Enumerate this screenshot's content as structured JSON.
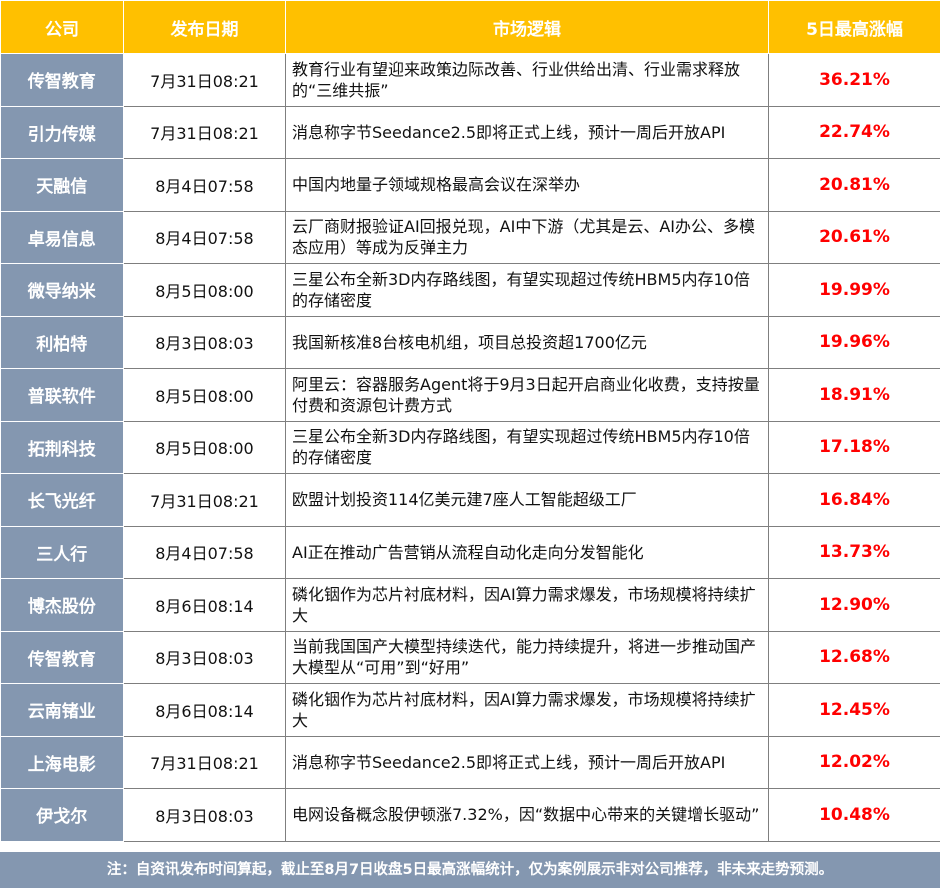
{
  "header": {
    "company": "公司",
    "date": "发布日期",
    "logic": "市场逻辑",
    "gain": "5日最高涨幅"
  },
  "rows": [
    {
      "company": "传智教育",
      "date": "7月31日08:21",
      "logic": "教育行业有望迎来政策边际改善、行业供给出清、行业需求释放的“三维共振”",
      "gain": "36.21%"
    },
    {
      "company": "引力传媒",
      "date": "7月31日08:21",
      "logic": "消息称字节Seedance2.5即将正式上线，预计一周后开放API",
      "gain": "22.74%"
    },
    {
      "company": "天融信",
      "date": "8月4日07:58",
      "logic": "中国内地量子领域规格最高会议在深举办",
      "gain": "20.81%"
    },
    {
      "company": "卓易信息",
      "date": "8月4日07:58",
      "logic": "云厂商财报验证AI回报兑现，AI中下游（尤其是云、AI办公、多模态应用）等成为反弹主力",
      "gain": "20.61%"
    },
    {
      "company": "微导纳米",
      "date": "8月5日08:00",
      "logic": "三星公布全新3D内存路线图，有望实现超过传统HBM5内存10倍的存储密度",
      "gain": "19.99%"
    },
    {
      "company": "利柏特",
      "date": "8月3日08:03",
      "logic": "我国新核准8台核电机组，项目总投资超1700亿元",
      "gain": "19.96%"
    },
    {
      "company": "普联软件",
      "date": "8月5日08:00",
      "logic": "阿里云：容器服务Agent将于9月3日起开启商业化收费，支持按量付费和资源包计费方式",
      "gain": "18.91%"
    },
    {
      "company": "拓荆科技",
      "date": "8月5日08:00",
      "logic": "三星公布全新3D内存路线图，有望实现超过传统HBM5内存10倍的存储密度",
      "gain": "17.18%"
    },
    {
      "company": "长飞光纤",
      "date": "7月31日08:21",
      "logic": "欧盟计划投资114亿美元建7座人工智能超级工厂",
      "gain": "16.84%"
    },
    {
      "company": "三人行",
      "date": "8月4日07:58",
      "logic": "AI正在推动广告营销从流程自动化走向分发智能化",
      "gain": "13.73%"
    },
    {
      "company": "博杰股份",
      "date": "8月6日08:14",
      "logic": "磷化铟作为芯片衬底材料，因AI算力需求爆发，市场规模将持续扩大",
      "gain": "12.90%"
    },
    {
      "company": "传智教育",
      "date": "8月3日08:03",
      "logic": "当前我国国产大模型持续迭代，能力持续提升，将进一步推动国产大模型从“可用”到“好用”",
      "gain": "12.68%"
    },
    {
      "company": "云南锗业",
      "date": "8月6日08:14",
      "logic": "磷化铟作为芯片衬底材料，因AI算力需求爆发，市场规模将持续扩大",
      "gain": "12.45%"
    },
    {
      "company": "上海电影",
      "date": "7月31日08:21",
      "logic": "消息称字节Seedance2.5即将正式上线，预计一周后开放API",
      "gain": "12.02%"
    },
    {
      "company": "伊戈尔",
      "date": "8月3日08:03",
      "logic": "电网设备概念股伊顿涨7.32%，因“数据中心带来的关键增长驱动”",
      "gain": "10.48%"
    }
  ],
  "footnote": "注：自资讯发布时间算起，截止至8月7日收盘5日最高涨幅统计，仅为案例展示非对公司推荐，非未来走势预测。",
  "colors": {
    "header_bg": "#ffc000",
    "company_bg": "#8497b0",
    "gain_text": "#ff0000"
  }
}
